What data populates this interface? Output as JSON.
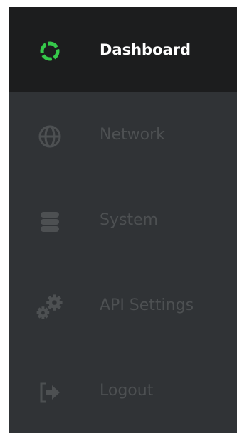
{
  "sidebar": {
    "accent_color": "#35c84a",
    "items": [
      {
        "label": "Dashboard",
        "icon": "dashboard-ring-icon",
        "active": true
      },
      {
        "label": "Network",
        "icon": "globe-icon",
        "active": false
      },
      {
        "label": "System",
        "icon": "database-icon",
        "active": false
      },
      {
        "label": "API Settings",
        "icon": "gears-icon",
        "active": false
      },
      {
        "label": "Logout",
        "icon": "logout-icon",
        "active": false
      }
    ]
  }
}
